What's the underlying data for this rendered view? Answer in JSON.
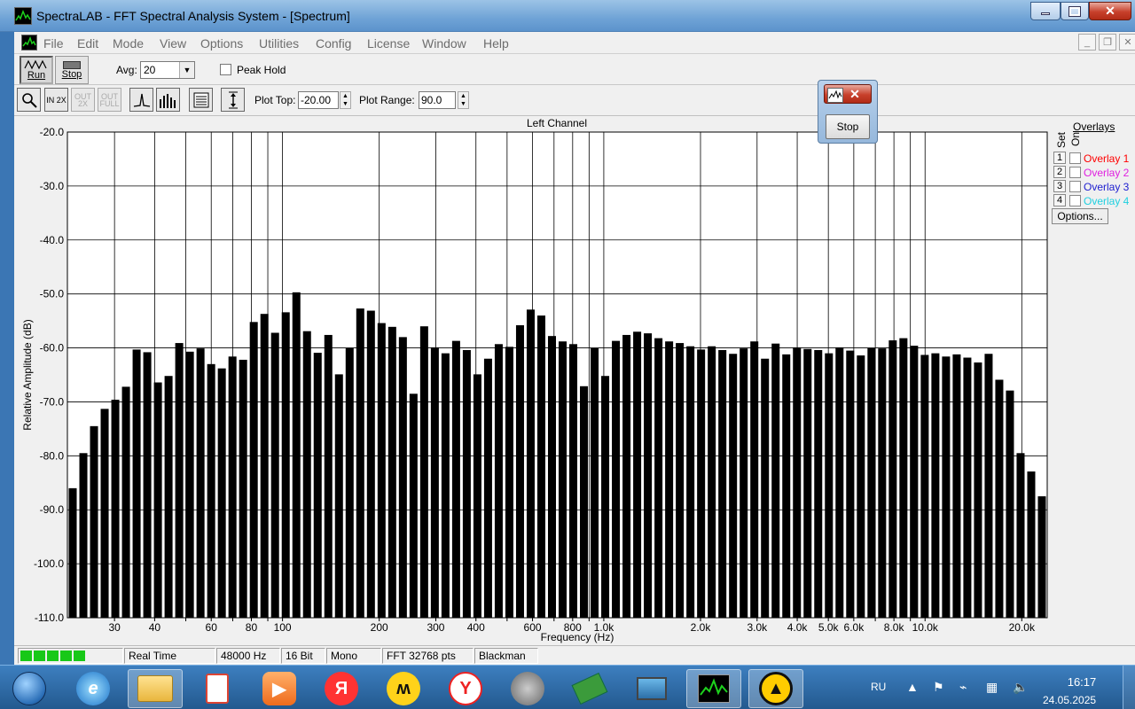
{
  "window": {
    "title": "SpectraLAB - FFT Spectral Analysis System - [Spectrum]"
  },
  "menu": [
    "File",
    "Edit",
    "Mode",
    "View",
    "Options",
    "Utilities",
    "Config",
    "License",
    "Window",
    "Help"
  ],
  "toolbar": {
    "run_label": "Run",
    "stop_label": "Stop",
    "avg_label": "Avg:",
    "avg_value": "20",
    "peak_hold_label": "Peak Hold",
    "plot_top_label": "Plot Top:",
    "plot_top_value": "-20.00",
    "plot_range_label": "Plot Range:",
    "plot_range_value": "90.0",
    "zoom_in_label": "IN 2X",
    "zoom_out_label": "OUT 2X",
    "zoom_full_label": "OUT FULL"
  },
  "floating_window": {
    "stop_label": "Stop"
  },
  "overlays": {
    "title": "Overlays",
    "set_label": "Set",
    "on_label": "On",
    "items": [
      {
        "num": "1",
        "label": "Overlay 1",
        "color": "#ff0000"
      },
      {
        "num": "2",
        "label": "Overlay 2",
        "color": "#e020e0"
      },
      {
        "num": "3",
        "label": "Overlay 3",
        "color": "#2020d0"
      },
      {
        "num": "4",
        "label": "Overlay 4",
        "color": "#20d0e0"
      }
    ],
    "options_label": "Options..."
  },
  "status": {
    "mode": "Real Time",
    "rate": "48000 Hz",
    "bits": "16 Bit",
    "channels": "Mono",
    "fft": "FFT 32768 pts",
    "window_fn": "Blackman"
  },
  "taskbar": {
    "lang": "RU",
    "time": "16:17",
    "date": "24.05.2025"
  },
  "chart_data": {
    "type": "bar",
    "title": "Left Channel",
    "xlabel": "Frequency (Hz)",
    "ylabel": "Relative Amplitude (dB)",
    "x_scale": "log",
    "ylim": [
      -110,
      -20
    ],
    "grid": true,
    "y_ticks": [
      "-20.0",
      "-30.0",
      "-40.0",
      "-50.0",
      "-60.0",
      "-70.0",
      "-80.0",
      "-90.0",
      "-100.0",
      "-110.0"
    ],
    "x_ticks": [
      {
        "f": 30,
        "label": "30"
      },
      {
        "f": 40,
        "label": "40"
      },
      {
        "f": 50,
        "label": ""
      },
      {
        "f": 60,
        "label": "60"
      },
      {
        "f": 70,
        "label": ""
      },
      {
        "f": 80,
        "label": "80"
      },
      {
        "f": 90,
        "label": ""
      },
      {
        "f": 100,
        "label": "100"
      },
      {
        "f": 200,
        "label": "200"
      },
      {
        "f": 300,
        "label": "300"
      },
      {
        "f": 400,
        "label": "400"
      },
      {
        "f": 500,
        "label": ""
      },
      {
        "f": 600,
        "label": "600"
      },
      {
        "f": 700,
        "label": ""
      },
      {
        "f": 800,
        "label": "800"
      },
      {
        "f": 900,
        "label": ""
      },
      {
        "f": 1000,
        "label": "1.0k"
      },
      {
        "f": 2000,
        "label": "2.0k"
      },
      {
        "f": 3000,
        "label": "3.0k"
      },
      {
        "f": 4000,
        "label": "4.0k"
      },
      {
        "f": 5000,
        "label": "5.0k"
      },
      {
        "f": 6000,
        "label": "6.0k"
      },
      {
        "f": 7000,
        "label": ""
      },
      {
        "f": 8000,
        "label": "8.0k"
      },
      {
        "f": 9000,
        "label": ""
      },
      {
        "f": 10000,
        "label": "10.0k"
      },
      {
        "f": 20000,
        "label": "20.0k"
      }
    ],
    "x_range_hz": [
      21.4,
      24000
    ],
    "values": [
      -86,
      -79.5,
      -74.5,
      -71.3,
      -69.6,
      -67.2,
      -60.3,
      -60.8,
      -66.4,
      -65.2,
      -59.1,
      -60.7,
      -60.1,
      -63,
      -63.8,
      -61.6,
      -62.2,
      -55.2,
      -53.7,
      -57.2,
      -53.4,
      -49.7,
      -56.9,
      -60.9,
      -57.6,
      -64.9,
      -60,
      -52.7,
      -53.1,
      -55.4,
      -56.1,
      -58,
      -68.5,
      -56,
      -59.9,
      -61,
      -58.7,
      -60.4,
      -64.9,
      -62,
      -59.3,
      -59.8,
      -55.8,
      -52.9,
      -54,
      -57.8,
      -58.8,
      -59.3,
      -67.1,
      -60,
      -65.2,
      -58.7,
      -57.6,
      -57,
      -57.3,
      -58.2,
      -58.8,
      -59.1,
      -59.7,
      -60.3,
      -59.7,
      -60.4,
      -61.1,
      -60.1,
      -58.8,
      -62,
      -59.2,
      -61.2,
      -59.9,
      -60.2,
      -60.4,
      -61,
      -59.9,
      -60.5,
      -61.4,
      -60,
      -60.1,
      -58.6,
      -58.2,
      -59.6,
      -61.3,
      -61,
      -61.6,
      -61.2,
      -61.8,
      -62.7,
      -61.1,
      -65.9,
      -67.9,
      -79.5,
      -82.9,
      -87.5
    ]
  }
}
